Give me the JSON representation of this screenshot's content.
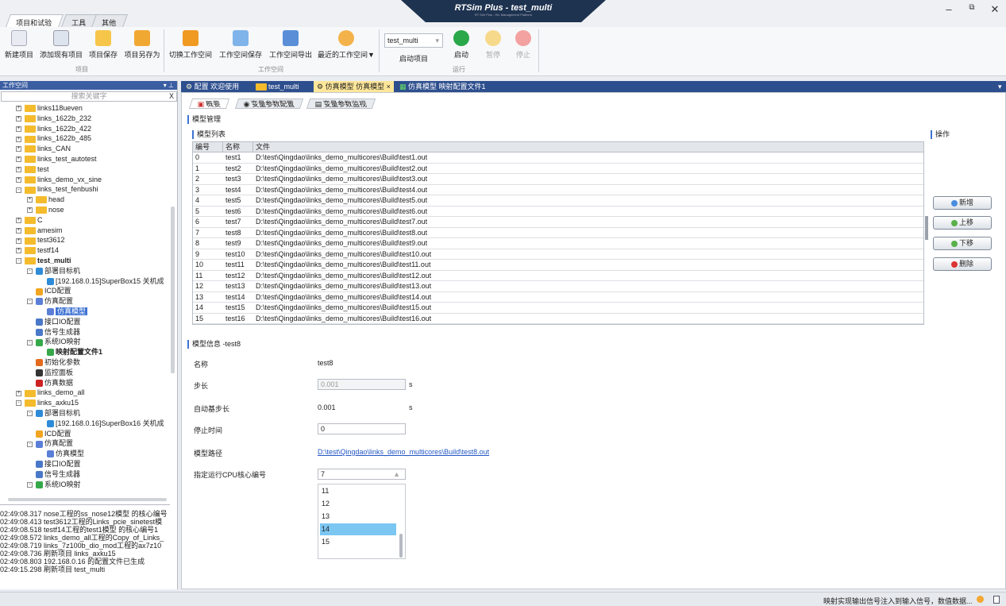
{
  "window": {
    "title": "RTSim Plus - test_multi",
    "subtitle": "RT Sim Plus - HIL Management Platform",
    "minimize": "–",
    "restore": "⧉",
    "close": "✕"
  },
  "top_tabs": [
    "项目和试验",
    "工具",
    "其他"
  ],
  "ribbon": {
    "buttons": [
      "新建项目",
      "添加现有项目",
      "项目保存",
      "项目另存为",
      "切换工作空间",
      "工作空间保存",
      "工作空间导出",
      "最近的工作空间▼"
    ],
    "project_select": "test_multi",
    "project_select_label": "启动项目",
    "run_buttons": [
      "启动",
      "暂停",
      "停止"
    ],
    "groups": [
      "项目",
      "工作空间",
      "运行"
    ]
  },
  "workspace": {
    "header": "工作空间",
    "pin": "▾ ⊥",
    "search_placeholder": "搜索关键字",
    "search_clear": "X"
  },
  "tree": [
    "links118ueven",
    "links_1622b_232",
    "links_1622b_422",
    "links_1622b_485",
    "links_CAN",
    "links_test_autotest",
    "test",
    "links_demo_vx_sine",
    "links_test_fenbushi",
    "head",
    "nose",
    "C",
    "amesim",
    "test3612",
    "testf14",
    "test_multi",
    "部署目标机",
    "[192.168.0.15]SuperBox15 关机成",
    "ICD配置",
    "仿真配置",
    "仿真模型",
    "接口IO配置",
    "信号生成器",
    "系统IO映射",
    "映射配置文件1",
    "初始化参数",
    "监控面板",
    "仿真数据",
    "links_demo_all",
    "links_axku15",
    "部署目标机",
    "[192.168.0.16]SuperBox16 关机成",
    "ICD配置",
    "仿真配置",
    "仿真模型",
    "接口IO配置",
    "信号生成器",
    "系统IO映射"
  ],
  "log": [
    "02:49:08.317 nose工程的ss_nose12模型 的核心编号",
    "02:49:08.413 test3612工程的Links_pcie_sinetest模",
    "02:49:08.518 testf14工程的test1模型 的核心编号1",
    "02:49:08.572 links_demo_all工程的Copy_of_Links_",
    "02:49:08.719 links_7z100b_dio_mod工程的ax7z10",
    "02:49:08.736 刷新项目 links_axku15",
    "02:49:08.803 192.168.0.16 的配置文件已生成",
    "02:49:15.298 刷新项目 test_multi"
  ],
  "main_tabs": [
    "配置 欢迎使用",
    "test_multi",
    "仿真模型 仿真模型 ×",
    "仿真模型 映射配置文件1"
  ],
  "sub_tabs": [
    "概要",
    "变量参数配置",
    "变量参数监视"
  ],
  "model_mgmt": "模型管理",
  "model_list": "模型列表",
  "ops_label": "操作",
  "grid": {
    "headers": [
      "编号",
      "名称",
      "文件"
    ],
    "rows": [
      [
        "0",
        "test1",
        "D:\\test\\Qingdao\\links_demo_multicores\\Build\\test1.out"
      ],
      [
        "1",
        "test2",
        "D:\\test\\Qingdao\\links_demo_multicores\\Build\\test2.out"
      ],
      [
        "2",
        "test3",
        "D:\\test\\Qingdao\\links_demo_multicores\\Build\\test3.out"
      ],
      [
        "3",
        "test4",
        "D:\\test\\Qingdao\\links_demo_multicores\\Build\\test4.out"
      ],
      [
        "4",
        "test5",
        "D:\\test\\Qingdao\\links_demo_multicores\\Build\\test5.out"
      ],
      [
        "5",
        "test6",
        "D:\\test\\Qingdao\\links_demo_multicores\\Build\\test6.out"
      ],
      [
        "6",
        "test7",
        "D:\\test\\Qingdao\\links_demo_multicores\\Build\\test7.out"
      ],
      [
        "7",
        "test8",
        "D:\\test\\Qingdao\\links_demo_multicores\\Build\\test8.out"
      ],
      [
        "8",
        "test9",
        "D:\\test\\Qingdao\\links_demo_multicores\\Build\\test9.out"
      ],
      [
        "9",
        "test10",
        "D:\\test\\Qingdao\\links_demo_multicores\\Build\\test10.out"
      ],
      [
        "10",
        "test11",
        "D:\\test\\Qingdao\\links_demo_multicores\\Build\\test11.out"
      ],
      [
        "11",
        "test12",
        "D:\\test\\Qingdao\\links_demo_multicores\\Build\\test12.out"
      ],
      [
        "12",
        "test13",
        "D:\\test\\Qingdao\\links_demo_multicores\\Build\\test13.out"
      ],
      [
        "13",
        "test14",
        "D:\\test\\Qingdao\\links_demo_multicores\\Build\\test14.out"
      ],
      [
        "14",
        "test15",
        "D:\\test\\Qingdao\\links_demo_multicores\\Build\\test15.out"
      ],
      [
        "15",
        "test16",
        "D:\\test\\Qingdao\\links_demo_multicores\\Build\\test16.out"
      ]
    ]
  },
  "ops": [
    "新增",
    "上移",
    "下移",
    "删除"
  ],
  "info": {
    "title": "模型信息 -test8",
    "name_label": "名称",
    "name": "test8",
    "step_label": "步长",
    "step": "0.001",
    "step_unit": "s",
    "base_label": "自动基步长",
    "base": "0.001",
    "base_unit": "s",
    "stop_label": "停止时间",
    "stop": "0",
    "path_label": "模型路径",
    "path": "D:\\test\\Qingdao\\links_demo_multicores\\Build\\test8.out",
    "cpu_label": "指定运行CPU核心编号",
    "cpu": "7",
    "cpu_options": [
      "11",
      "12",
      "13",
      "14",
      "15"
    ]
  },
  "status": "映射实现输出信号注入到输入信号，数值数据..."
}
